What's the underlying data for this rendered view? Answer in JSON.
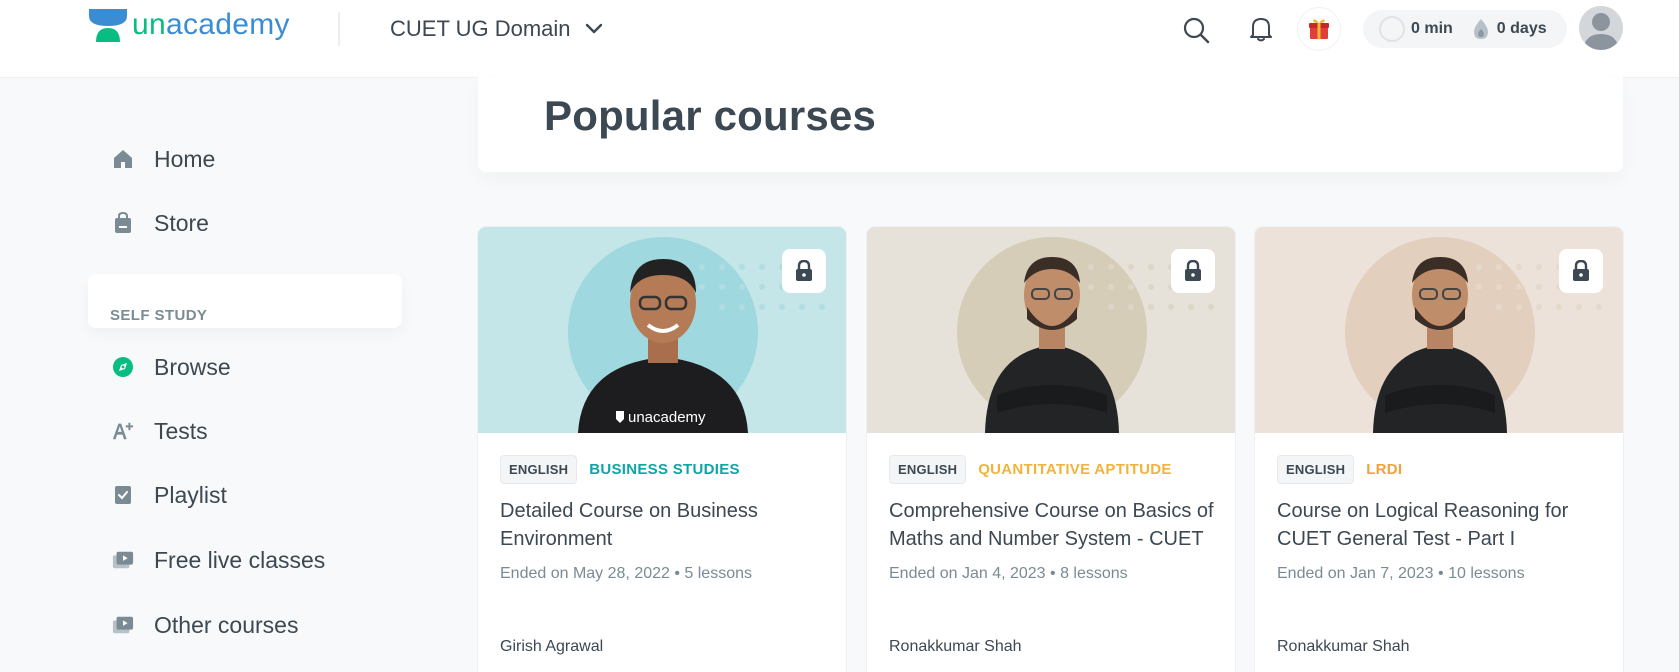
{
  "brand": {
    "logo_text_a": "un",
    "logo_text_b": "academy"
  },
  "header": {
    "goal": "CUET UG Domain",
    "streak_minutes": "0 min",
    "streak_days": "0 days"
  },
  "sidebar": {
    "items_top": [
      {
        "label": "Home",
        "icon": "home-icon"
      },
      {
        "label": "Store",
        "icon": "store-bag-icon"
      }
    ],
    "section_label": "SELF STUDY",
    "items": [
      {
        "label": "Browse",
        "icon": "compass-icon"
      },
      {
        "label": "Tests",
        "icon": "test-icon"
      },
      {
        "label": "Playlist",
        "icon": "playlist-icon"
      },
      {
        "label": "Free live classes",
        "icon": "video-icon"
      },
      {
        "label": "Other courses",
        "icon": "video-icon"
      }
    ]
  },
  "main": {
    "title": "Popular courses",
    "courses": [
      {
        "language": "ENGLISH",
        "topic": "BUSINESS STUDIES",
        "topic_color": "#0ea5a8",
        "title": "Detailed Course on Business Environment",
        "meta": "Ended on May 28, 2022 • 5 lessons",
        "author": "Girish Agrawal",
        "thumb_bg": "#c4e6e9",
        "bubble": "#9fd8de",
        "shirt_text": "unacademy"
      },
      {
        "language": "ENGLISH",
        "topic": "QUANTITATIVE APTITUDE",
        "topic_color": "#f2b33d",
        "title": "Comprehensive Course on Basics of Maths and Number System - CUET",
        "meta": "Ended on Jan 4, 2023 • 8 lessons",
        "author": "Ronakkumar Shah",
        "thumb_bg": "#e6e2da",
        "bubble": "#d6cdb9"
      },
      {
        "language": "ENGLISH",
        "topic": "LRDI",
        "topic_color": "#f2a23d",
        "title": "Course on Logical Reasoning for CUET General Test - Part I",
        "meta": "Ended on Jan 7, 2023 • 10 lessons",
        "author": "Ronakkumar Shah",
        "thumb_bg": "#ece2da",
        "bubble": "#e2cfbd"
      }
    ]
  }
}
